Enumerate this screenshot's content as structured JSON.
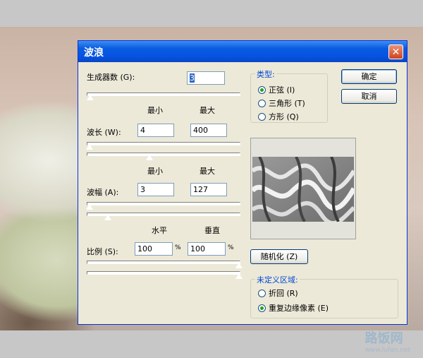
{
  "dialog": {
    "title": "波浪",
    "close_glyph": "✕",
    "generators": {
      "label": "生成器数 (G):",
      "value": "3"
    },
    "col_headers_1": {
      "min": "最小",
      "max": "最大"
    },
    "wavelength": {
      "label": "波长 (W):",
      "min": "4",
      "max": "400"
    },
    "col_headers_2": {
      "min": "最小",
      "max": "最大"
    },
    "amplitude": {
      "label": "波幅 (A):",
      "min": "3",
      "max": "127"
    },
    "scale_headers": {
      "horizontal": "水平",
      "vertical": "垂直"
    },
    "scale": {
      "label": "比例 (S):",
      "horizontal": "100",
      "vertical": "100",
      "unit": "%"
    },
    "type_group": {
      "title": "类型:",
      "options": [
        "正弦 (I)",
        "三角形 (T)",
        "方形 (Q)"
      ],
      "selected_index": 0
    },
    "ok_label": "确定",
    "cancel_label": "取消",
    "randomize_label": "随机化 (Z)",
    "undefined_group": {
      "title": "未定义区域:",
      "options": [
        "折回 (R)",
        "重复边缘像素 (E)"
      ],
      "selected_index": 1
    }
  },
  "watermark": {
    "main": "路饭网",
    "sub": "www.lufan.net"
  },
  "colors": {
    "titlebar": "#0554e3",
    "dialog_bg": "#ece9d8",
    "group_title": "#0046d5"
  }
}
